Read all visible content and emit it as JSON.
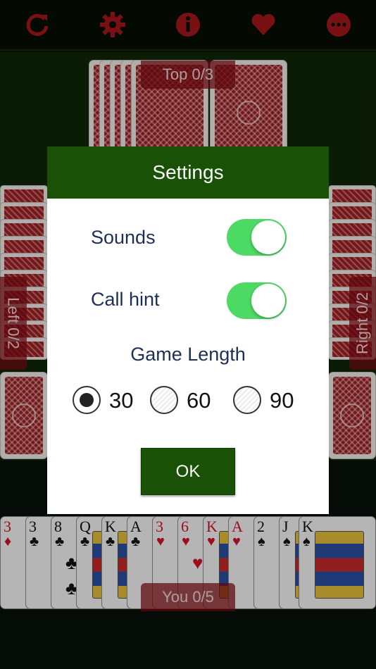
{
  "toolbar": {
    "icons": [
      "refresh-icon",
      "gear-icon",
      "info-icon",
      "heart-icon",
      "more-icon"
    ],
    "icon_color": "#a8181c"
  },
  "players": {
    "top": "Top   0/3",
    "left": "Left   0/2",
    "right": "Right  0/2",
    "you": "You   0/5"
  },
  "hand": [
    {
      "rank": "3",
      "suit": "♦",
      "color": "red"
    },
    {
      "rank": "3",
      "suit": "♣",
      "color": "black"
    },
    {
      "rank": "8",
      "suit": "♣",
      "color": "black"
    },
    {
      "rank": "Q",
      "suit": "♣",
      "color": "black"
    },
    {
      "rank": "K",
      "suit": "♣",
      "color": "black"
    },
    {
      "rank": "A",
      "suit": "♣",
      "color": "black"
    },
    {
      "rank": "3",
      "suit": "♥",
      "color": "red"
    },
    {
      "rank": "6",
      "suit": "♥",
      "color": "red"
    },
    {
      "rank": "K",
      "suit": "♥",
      "color": "red"
    },
    {
      "rank": "A",
      "suit": "♥",
      "color": "red"
    },
    {
      "rank": "2",
      "suit": "♠",
      "color": "black"
    },
    {
      "rank": "J",
      "suit": "♠",
      "color": "black"
    },
    {
      "rank": "K",
      "suit": "♠",
      "color": "black"
    }
  ],
  "dialog": {
    "title": "Settings",
    "sounds_label": "Sounds",
    "sounds_on": true,
    "hint_label": "Call hint",
    "hint_on": true,
    "game_length_title": "Game Length",
    "options": [
      "30",
      "60",
      "90"
    ],
    "selected": "30",
    "ok_label": "OK"
  },
  "colors": {
    "header_green": "#195207",
    "toggle_on": "#4cd964",
    "felt": "#0f2609",
    "label_text": "#1d2f56"
  }
}
